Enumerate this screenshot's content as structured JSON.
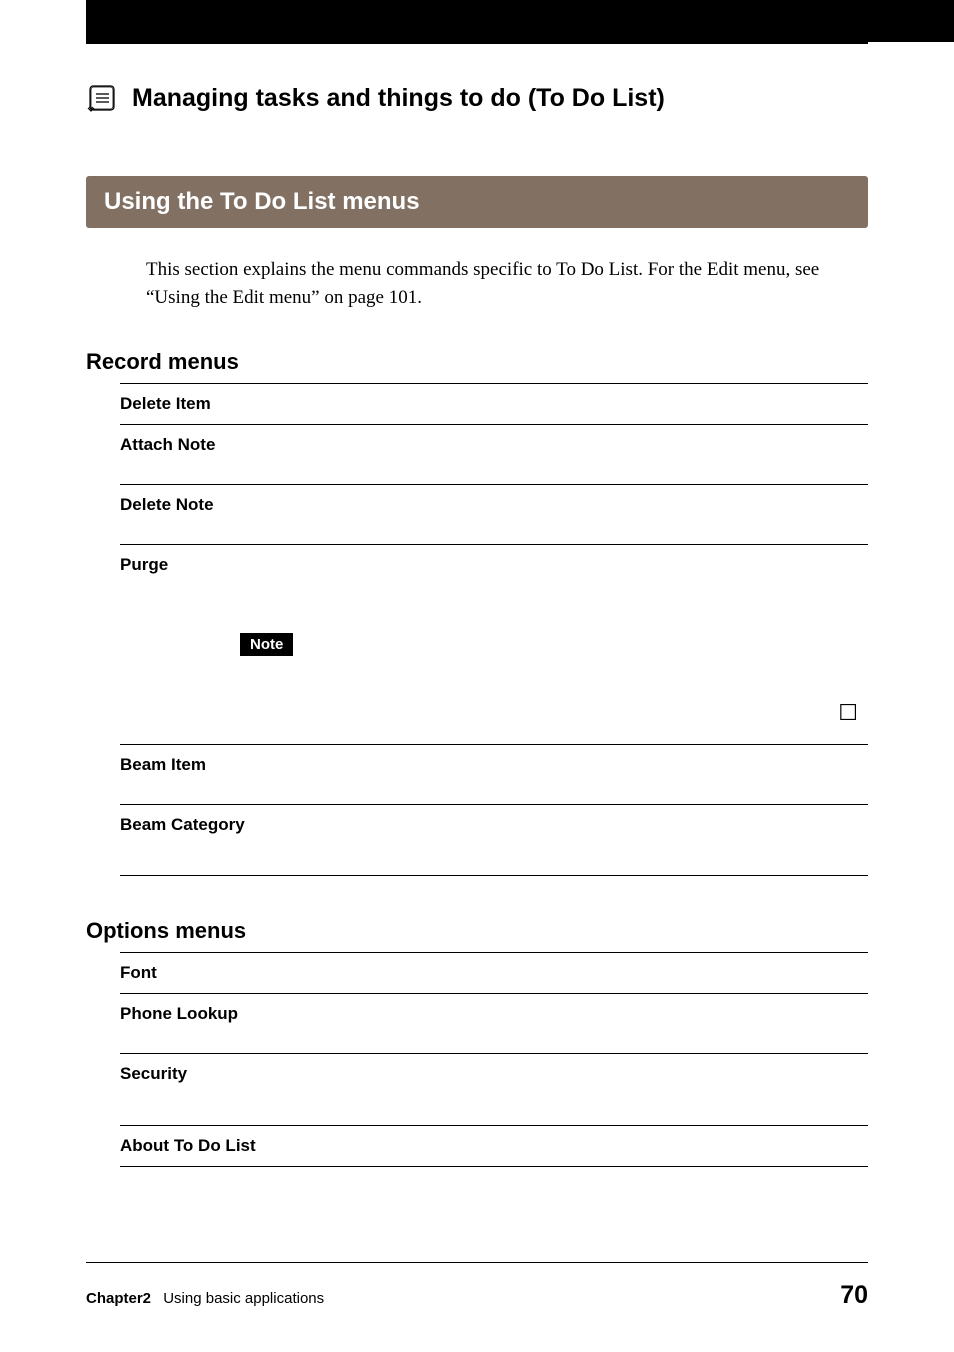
{
  "header": {
    "title": "Managing tasks and things to do (To Do List)"
  },
  "section": {
    "heading": "Using the To Do List menus",
    "intro": "This section explains the menu commands specific to To Do List. For the Edit menu, see “Using the Edit menu” on page 101."
  },
  "record_menus": {
    "heading": "Record menus",
    "items": [
      {
        "label": "Delete Item"
      },
      {
        "label": "Attach Note"
      },
      {
        "label": "Delete Note"
      },
      {
        "label": "Purge",
        "note_tag": "Note",
        "checkbox": "☐"
      },
      {
        "label": "Beam Item"
      },
      {
        "label": "Beam Category"
      }
    ]
  },
  "options_menus": {
    "heading": "Options menus",
    "items": [
      {
        "label": "Font"
      },
      {
        "label": "Phone Lookup"
      },
      {
        "label": "Security"
      },
      {
        "label": "About To Do List"
      }
    ]
  },
  "footer": {
    "chapter": "Chapter2",
    "section": "Using basic applications",
    "page": "70"
  }
}
